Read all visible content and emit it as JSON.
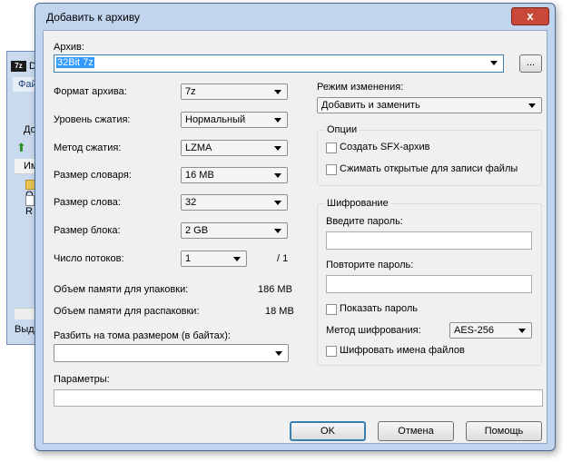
{
  "background_window": {
    "title": "D:",
    "app_icon": "7z",
    "menu_label": "Файл",
    "add_label": "Доб",
    "column_header": "Имя",
    "items": [
      "O",
      "R"
    ],
    "status": "Выдел"
  },
  "dialog": {
    "title": "Добавить к архиву",
    "close_glyph": "x"
  },
  "archive": {
    "label": "Архив:",
    "value": "32Bit 7z",
    "browse_label": "..."
  },
  "left": {
    "format": {
      "label": "Формат архива:",
      "value": "7z"
    },
    "level": {
      "label": "Уровень сжатия:",
      "value": "Нормальный"
    },
    "method": {
      "label": "Метод сжатия:",
      "value": "LZMA"
    },
    "dict": {
      "label": "Размер словаря:",
      "value": "16 MB"
    },
    "word": {
      "label": "Размер слова:",
      "value": "32"
    },
    "block": {
      "label": "Размер блока:",
      "value": "2 GB"
    },
    "threads": {
      "label": "Число потоков:",
      "value": "1",
      "max": "/ 1"
    },
    "mem_pack": {
      "label": "Объем памяти для упаковки:",
      "value": "186 MB"
    },
    "mem_unpack": {
      "label": "Объем памяти для распаковки:",
      "value": "18 MB"
    },
    "split": {
      "label": "Разбить на тома размером (в байтах):",
      "value": ""
    }
  },
  "params": {
    "label": "Параметры:",
    "value": ""
  },
  "right": {
    "update_mode": {
      "label": "Режим изменения:",
      "value": "Добавить и заменить"
    },
    "options": {
      "title": "Опции",
      "sfx": "Создать SFX-архив",
      "shared": "Сжимать открытые для записи файлы"
    },
    "encryption": {
      "title": "Шифрование",
      "password_label": "Введите пароль:",
      "repeat_label": "Повторите пароль:",
      "show_password": "Показать пароль",
      "method_label": "Метод шифрования:",
      "method_value": "AES-256",
      "encrypt_names": "Шифровать имена файлов"
    }
  },
  "buttons": {
    "ok": "OK",
    "cancel": "Отмена",
    "help": "Помощь"
  },
  "colors": {
    "accent": "#3c7fb1",
    "selection": "#3399ff",
    "close": "#c9483a"
  }
}
